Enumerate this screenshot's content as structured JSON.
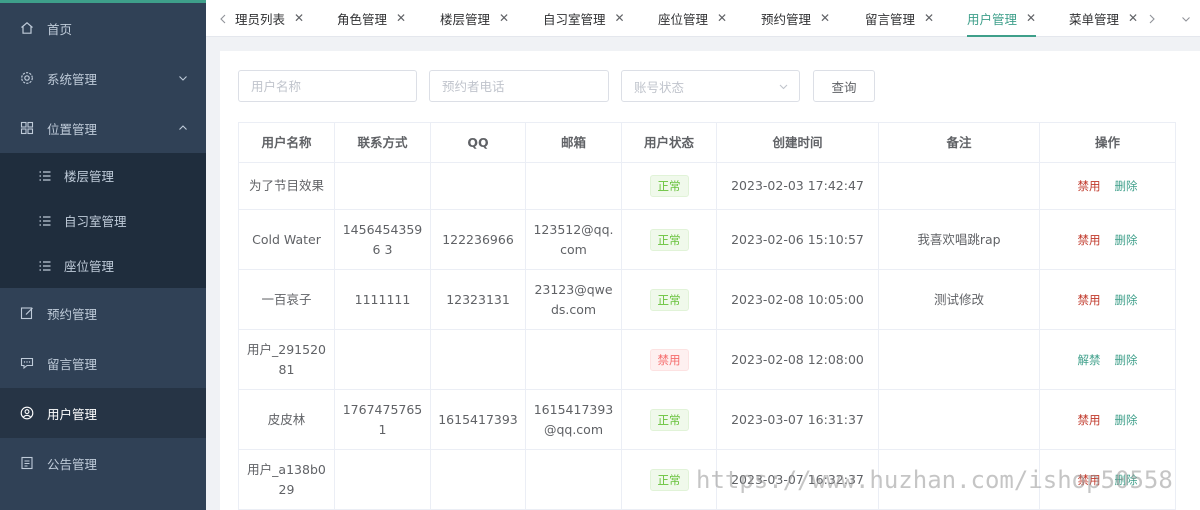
{
  "colors": {
    "accent": "#3e9f8a",
    "sidebar_bg": "#304156",
    "danger": "#c0392b",
    "ok_text": "#67c23a",
    "bad_text": "#f56c6c"
  },
  "sidebar": {
    "items": [
      {
        "label": "首页",
        "icon": "home-icon"
      },
      {
        "label": "系统管理",
        "icon": "gear-icon"
      },
      {
        "label": "位置管理",
        "icon": "grid-icon"
      },
      {
        "label": "楼层管理",
        "icon": "list-icon"
      },
      {
        "label": "自习室管理",
        "icon": "list-icon"
      },
      {
        "label": "座位管理",
        "icon": "list-icon"
      },
      {
        "label": "预约管理",
        "icon": "edit-icon"
      },
      {
        "label": "留言管理",
        "icon": "message-icon"
      },
      {
        "label": "用户管理",
        "icon": "user-icon"
      },
      {
        "label": "公告管理",
        "icon": "document-icon"
      }
    ]
  },
  "tabs": [
    {
      "label": "理员列表"
    },
    {
      "label": "角色管理"
    },
    {
      "label": "楼层管理"
    },
    {
      "label": "自习室管理"
    },
    {
      "label": "座位管理"
    },
    {
      "label": "预约管理"
    },
    {
      "label": "留言管理"
    },
    {
      "label": "用户管理"
    },
    {
      "label": "菜单管理"
    }
  ],
  "search": {
    "username_placeholder": "用户名称",
    "phone_placeholder": "预约者电话",
    "status_placeholder": "账号状态",
    "query_label": "查询"
  },
  "table": {
    "headers": [
      "用户名称",
      "联系方式",
      "QQ",
      "邮箱",
      "用户状态",
      "创建时间",
      "备注",
      "操作"
    ],
    "rows": [
      {
        "name": "为了节目效果",
        "phone": "",
        "qq": "",
        "email": "",
        "status": "正常",
        "created": "2023-02-03 17:42:47",
        "remark": "",
        "action1": "禁用",
        "action2": "删除"
      },
      {
        "name": "Cold Water",
        "phone": "14564543596 3",
        "qq": "122236966",
        "email": "123512@qq. com",
        "status": "正常",
        "created": "2023-02-06 15:10:57",
        "remark": "我喜欢唱跳rap",
        "action1": "禁用",
        "action2": "删除"
      },
      {
        "name": "一百哀子",
        "phone": "1111111",
        "qq": "12323131",
        "email": "23123@qwe ds.com",
        "status": "正常",
        "created": "2023-02-08 10:05:00",
        "remark": "测试修改",
        "action1": "禁用",
        "action2": "删除"
      },
      {
        "name": "用户_291520 81",
        "phone": "",
        "qq": "",
        "email": "",
        "status": "禁用",
        "created": "2023-02-08 12:08:00",
        "remark": "",
        "action1": "解禁",
        "action2": "删除"
      },
      {
        "name": "皮皮林",
        "phone": "17674757651",
        "qq": "1615417393",
        "email": "1615417393 @qq.com",
        "status": "正常",
        "created": "2023-03-07 16:31:37",
        "remark": "",
        "action1": "禁用",
        "action2": "删除"
      },
      {
        "name": "用户_a138b0 29",
        "phone": "",
        "qq": "",
        "email": "",
        "status": "正常",
        "created": "2023-03-07 16:32:37",
        "remark": "",
        "action1": "禁用",
        "action2": "删除"
      }
    ]
  },
  "watermark": "https://www.huzhan.com/ishop50558"
}
